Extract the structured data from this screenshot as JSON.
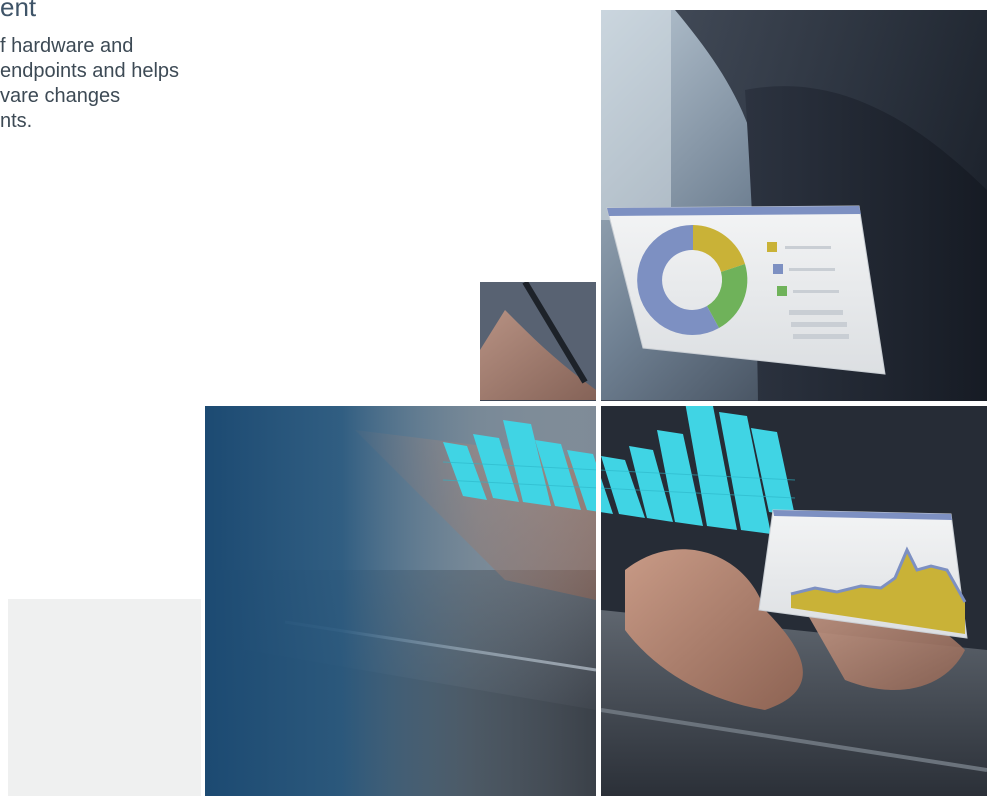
{
  "intro": {
    "heading_fragment": "ent",
    "description_lines": [
      "f hardware and",
      "endpoints and helps",
      "vare changes",
      "nts."
    ]
  },
  "image": {
    "description": "",
    "colors": {
      "navy": "#1c4a72",
      "cyan": "#3fd3e3",
      "mustard": "#c9b237",
      "slate_blue": "#7d90c2",
      "green": "#6fb25a"
    }
  }
}
